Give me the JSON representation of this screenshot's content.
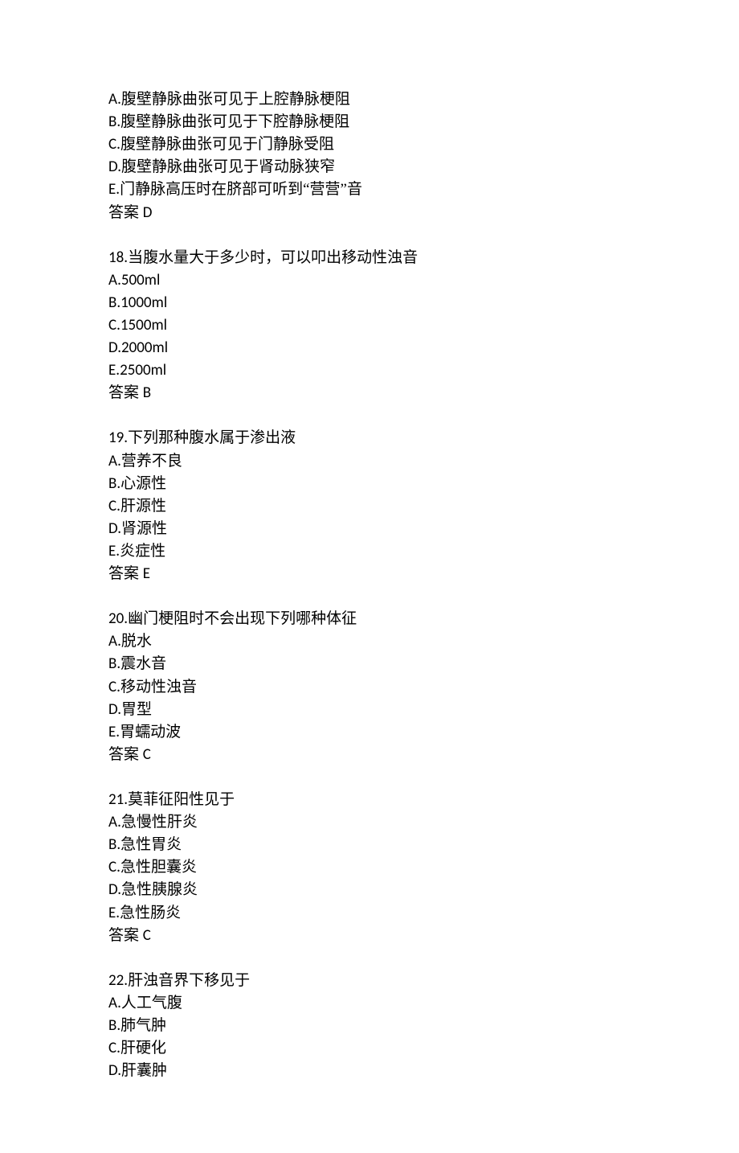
{
  "answer_label_prefix": "答案 ",
  "questions": [
    {
      "number": "",
      "stem": "",
      "options": [
        "A.腹壁静脉曲张可见于上腔静脉梗阻",
        "B.腹壁静脉曲张可见于下腔静脉梗阻",
        "C.腹壁静脉曲张可见于门静脉受阻",
        "D.腹壁静脉曲张可见于肾动脉狭窄",
        "E.门静脉高压时在脐部可听到“营营”音"
      ],
      "answer": "D"
    },
    {
      "number": "18.",
      "stem": "当腹水量大于多少时，可以叩出移动性浊音",
      "options": [
        "A.500ml",
        "B.1000ml",
        "C.1500ml",
        "D.2000ml",
        "E.2500ml"
      ],
      "answer": "B"
    },
    {
      "number": "19.",
      "stem": "下列那种腹水属于渗出液",
      "options": [
        "A.营养不良",
        "B.心源性",
        "C.肝源性",
        "D.肾源性",
        "E.炎症性"
      ],
      "answer": "E"
    },
    {
      "number": "20.",
      "stem": "幽门梗阻时不会出现下列哪种体征",
      "options": [
        "A.脱水",
        "B.震水音",
        "C.移动性浊音",
        "D.胃型",
        "E.胃蠕动波"
      ],
      "answer": "C"
    },
    {
      "number": "21.",
      "stem": "莫菲征阳性见于",
      "options": [
        "A.急慢性肝炎",
        "B.急性胃炎",
        "C.急性胆囊炎",
        "D.急性胰腺炎",
        "E.急性肠炎"
      ],
      "answer": "C"
    },
    {
      "number": "22.",
      "stem": "肝浊音界下移见于",
      "options": [
        "A.人工气腹",
        "B.肺气肿",
        "C.肝硬化",
        "D.肝囊肿"
      ],
      "answer": ""
    }
  ]
}
